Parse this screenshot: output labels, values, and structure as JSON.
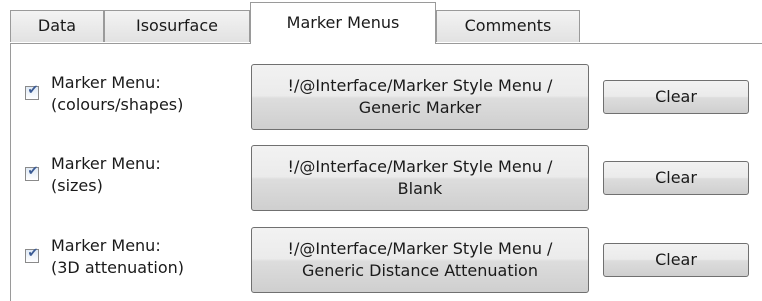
{
  "tabs": [
    {
      "label": "Data",
      "active": false
    },
    {
      "label": "Isosurface",
      "active": false
    },
    {
      "label": "Marker Menus",
      "active": true
    },
    {
      "label": "Comments",
      "active": false
    }
  ],
  "rows": [
    {
      "checked": true,
      "label_line1": "Marker Menu:",
      "label_line2": "(colours/shapes)",
      "path_line1": "!/@Interface/Marker Style Menu /",
      "path_line2": "Generic Marker",
      "clear_label": "Clear"
    },
    {
      "checked": true,
      "label_line1": "Marker Menu:",
      "label_line2": "(sizes)",
      "path_line1": "!/@Interface/Marker Style Menu /",
      "path_line2": "Blank",
      "clear_label": "Clear"
    },
    {
      "checked": true,
      "label_line1": "Marker Menu:",
      "label_line2": "(3D attenuation)",
      "path_line1": "!/@Interface/Marker Style Menu /",
      "path_line2": "Generic Distance Attenuation",
      "clear_label": "Clear"
    }
  ],
  "icons": {
    "checkbox": "checkmark-icon"
  },
  "colors": {
    "checkmark": "#3a5a94",
    "border": "#9a9a9a"
  }
}
